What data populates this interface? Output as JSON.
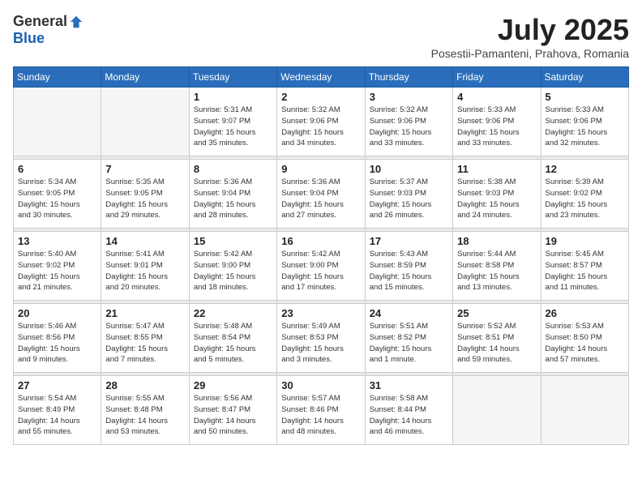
{
  "header": {
    "logo_general": "General",
    "logo_blue": "Blue",
    "month_title": "July 2025",
    "location": "Posestii-Pamanteni, Prahova, Romania"
  },
  "days_of_week": [
    "Sunday",
    "Monday",
    "Tuesday",
    "Wednesday",
    "Thursday",
    "Friday",
    "Saturday"
  ],
  "weeks": [
    {
      "days": [
        {
          "number": "",
          "detail": ""
        },
        {
          "number": "",
          "detail": ""
        },
        {
          "number": "1",
          "detail": "Sunrise: 5:31 AM\nSunset: 9:07 PM\nDaylight: 15 hours\nand 35 minutes."
        },
        {
          "number": "2",
          "detail": "Sunrise: 5:32 AM\nSunset: 9:06 PM\nDaylight: 15 hours\nand 34 minutes."
        },
        {
          "number": "3",
          "detail": "Sunrise: 5:32 AM\nSunset: 9:06 PM\nDaylight: 15 hours\nand 33 minutes."
        },
        {
          "number": "4",
          "detail": "Sunrise: 5:33 AM\nSunset: 9:06 PM\nDaylight: 15 hours\nand 33 minutes."
        },
        {
          "number": "5",
          "detail": "Sunrise: 5:33 AM\nSunset: 9:06 PM\nDaylight: 15 hours\nand 32 minutes."
        }
      ]
    },
    {
      "days": [
        {
          "number": "6",
          "detail": "Sunrise: 5:34 AM\nSunset: 9:05 PM\nDaylight: 15 hours\nand 30 minutes."
        },
        {
          "number": "7",
          "detail": "Sunrise: 5:35 AM\nSunset: 9:05 PM\nDaylight: 15 hours\nand 29 minutes."
        },
        {
          "number": "8",
          "detail": "Sunrise: 5:36 AM\nSunset: 9:04 PM\nDaylight: 15 hours\nand 28 minutes."
        },
        {
          "number": "9",
          "detail": "Sunrise: 5:36 AM\nSunset: 9:04 PM\nDaylight: 15 hours\nand 27 minutes."
        },
        {
          "number": "10",
          "detail": "Sunrise: 5:37 AM\nSunset: 9:03 PM\nDaylight: 15 hours\nand 26 minutes."
        },
        {
          "number": "11",
          "detail": "Sunrise: 5:38 AM\nSunset: 9:03 PM\nDaylight: 15 hours\nand 24 minutes."
        },
        {
          "number": "12",
          "detail": "Sunrise: 5:39 AM\nSunset: 9:02 PM\nDaylight: 15 hours\nand 23 minutes."
        }
      ]
    },
    {
      "days": [
        {
          "number": "13",
          "detail": "Sunrise: 5:40 AM\nSunset: 9:02 PM\nDaylight: 15 hours\nand 21 minutes."
        },
        {
          "number": "14",
          "detail": "Sunrise: 5:41 AM\nSunset: 9:01 PM\nDaylight: 15 hours\nand 20 minutes."
        },
        {
          "number": "15",
          "detail": "Sunrise: 5:42 AM\nSunset: 9:00 PM\nDaylight: 15 hours\nand 18 minutes."
        },
        {
          "number": "16",
          "detail": "Sunrise: 5:42 AM\nSunset: 9:00 PM\nDaylight: 15 hours\nand 17 minutes."
        },
        {
          "number": "17",
          "detail": "Sunrise: 5:43 AM\nSunset: 8:59 PM\nDaylight: 15 hours\nand 15 minutes."
        },
        {
          "number": "18",
          "detail": "Sunrise: 5:44 AM\nSunset: 8:58 PM\nDaylight: 15 hours\nand 13 minutes."
        },
        {
          "number": "19",
          "detail": "Sunrise: 5:45 AM\nSunset: 8:57 PM\nDaylight: 15 hours\nand 11 minutes."
        }
      ]
    },
    {
      "days": [
        {
          "number": "20",
          "detail": "Sunrise: 5:46 AM\nSunset: 8:56 PM\nDaylight: 15 hours\nand 9 minutes."
        },
        {
          "number": "21",
          "detail": "Sunrise: 5:47 AM\nSunset: 8:55 PM\nDaylight: 15 hours\nand 7 minutes."
        },
        {
          "number": "22",
          "detail": "Sunrise: 5:48 AM\nSunset: 8:54 PM\nDaylight: 15 hours\nand 5 minutes."
        },
        {
          "number": "23",
          "detail": "Sunrise: 5:49 AM\nSunset: 8:53 PM\nDaylight: 15 hours\nand 3 minutes."
        },
        {
          "number": "24",
          "detail": "Sunrise: 5:51 AM\nSunset: 8:52 PM\nDaylight: 15 hours\nand 1 minute."
        },
        {
          "number": "25",
          "detail": "Sunrise: 5:52 AM\nSunset: 8:51 PM\nDaylight: 14 hours\nand 59 minutes."
        },
        {
          "number": "26",
          "detail": "Sunrise: 5:53 AM\nSunset: 8:50 PM\nDaylight: 14 hours\nand 57 minutes."
        }
      ]
    },
    {
      "days": [
        {
          "number": "27",
          "detail": "Sunrise: 5:54 AM\nSunset: 8:49 PM\nDaylight: 14 hours\nand 55 minutes."
        },
        {
          "number": "28",
          "detail": "Sunrise: 5:55 AM\nSunset: 8:48 PM\nDaylight: 14 hours\nand 53 minutes."
        },
        {
          "number": "29",
          "detail": "Sunrise: 5:56 AM\nSunset: 8:47 PM\nDaylight: 14 hours\nand 50 minutes."
        },
        {
          "number": "30",
          "detail": "Sunrise: 5:57 AM\nSunset: 8:46 PM\nDaylight: 14 hours\nand 48 minutes."
        },
        {
          "number": "31",
          "detail": "Sunrise: 5:58 AM\nSunset: 8:44 PM\nDaylight: 14 hours\nand 46 minutes."
        },
        {
          "number": "",
          "detail": ""
        },
        {
          "number": "",
          "detail": ""
        }
      ]
    }
  ]
}
